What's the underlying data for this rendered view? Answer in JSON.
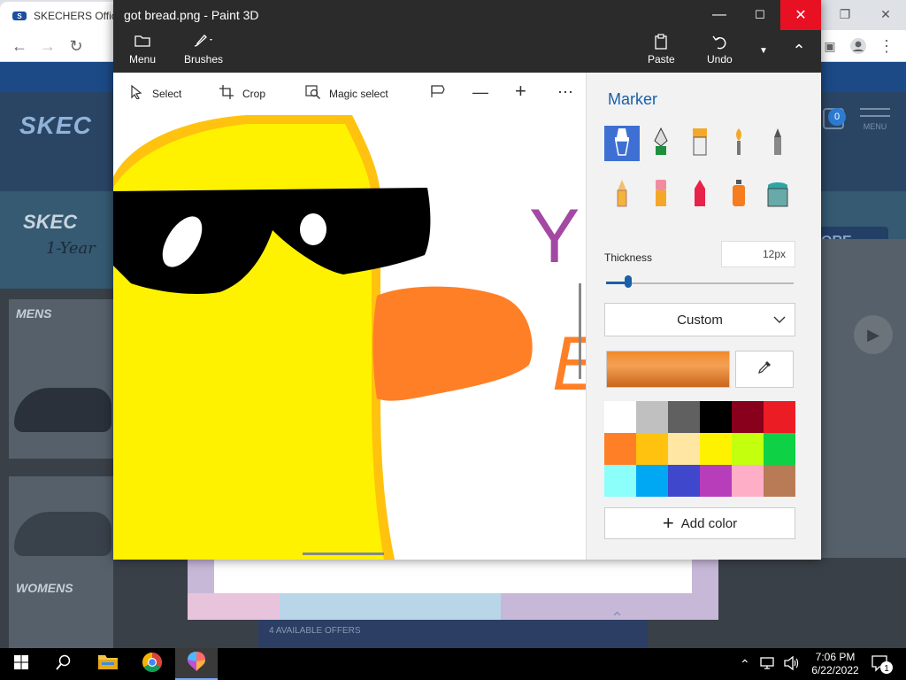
{
  "browser": {
    "tab_title": "SKECHERS Offic",
    "tab_favicon": "S",
    "page": {
      "logo": "SKEC",
      "banner_logo": "SKEC",
      "banner_sub": "1-Year",
      "more_button": "ORE",
      "cart_count": "0",
      "menu_label": "MENU",
      "mens_label": "MENS",
      "womens_label": "WOMENS",
      "offers_text": "4 AVAILABLE OFFERS"
    }
  },
  "paint": {
    "title": "got bread.png - Paint 3D",
    "toolbar": {
      "menu": "Menu",
      "brushes": "Brushes",
      "paste": "Paste",
      "undo": "Undo"
    },
    "commands": {
      "select": "Select",
      "crop": "Crop",
      "magic_select": "Magic select"
    },
    "panel": {
      "title": "Marker",
      "brushes": [
        "marker-icon",
        "calligraphy-pen-icon",
        "oil-brush-icon",
        "watercolor-icon",
        "pixel-pen-icon",
        "pencil-icon",
        "eraser-icon",
        "crayon-icon",
        "spray-can-icon",
        "fill-icon"
      ],
      "thickness_label": "Thickness",
      "thickness_value": "12px",
      "thickness_fraction": 0.12,
      "dropdown_value": "Custom",
      "current_color": "#f0862a",
      "palette": [
        "#ffffff",
        "#c0c0c0",
        "#606060",
        "#000000",
        "#88001b",
        "#ec1c24",
        "#ff7f27",
        "#ffc20e",
        "#ffe6a3",
        "#fff200",
        "#c4ff0e",
        "#0ed145",
        "#8cfffb",
        "#00a8f3",
        "#3f48cc",
        "#b83dba",
        "#ffaec8",
        "#b97a56"
      ],
      "add_color": "Add color"
    }
  },
  "taskbar": {
    "time": "7:06 PM",
    "date": "6/22/2022",
    "notification_count": "1"
  }
}
